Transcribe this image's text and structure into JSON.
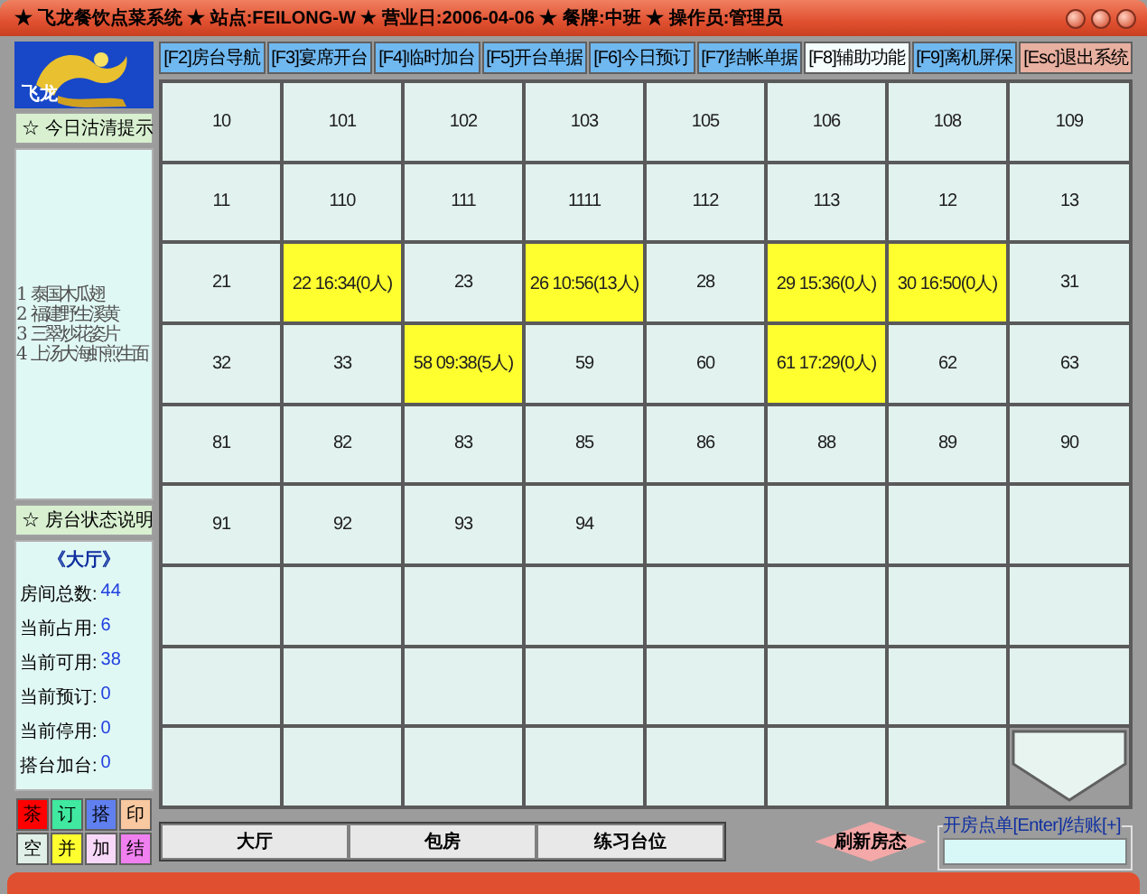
{
  "window": {
    "title": "★ 飞龙餐饮点菜系统 ★ 站点:FEILONG-W ★ 营业日:2006-04-06 ★ 餐牌:中班 ★ 操作员:管理员"
  },
  "logo": {
    "text": "飞龙"
  },
  "toolbar": [
    {
      "label": "[F2]房台导航",
      "selected": false,
      "kind": "normal"
    },
    {
      "label": "[F3]宴席开台",
      "selected": false,
      "kind": "normal"
    },
    {
      "label": "[F4]临时加台",
      "selected": false,
      "kind": "normal"
    },
    {
      "label": "[F5]开台单据",
      "selected": false,
      "kind": "normal"
    },
    {
      "label": "[F6]今日预订",
      "selected": false,
      "kind": "normal"
    },
    {
      "label": "[F7]结帐单据",
      "selected": false,
      "kind": "normal"
    },
    {
      "label": "[F8]辅助功能",
      "selected": true,
      "kind": "normal"
    },
    {
      "label": "[F9]离机屏保",
      "selected": false,
      "kind": "normal"
    },
    {
      "label": "[Esc]退出系统",
      "selected": false,
      "kind": "exit"
    }
  ],
  "sold_out": {
    "title": "☆ 今日沽清提示",
    "items": [
      {
        "number": "1",
        "name": "泰国木瓜翅"
      },
      {
        "number": "2",
        "name": "福建野生溪黄"
      },
      {
        "number": "3",
        "name": "三翠炒花姿片"
      },
      {
        "number": "4",
        "name": "上汤大海虾煎生面"
      }
    ]
  },
  "status_panel": {
    "title": "☆ 房台状态说明",
    "hall": "《大厅》",
    "stats": [
      {
        "label": "房间总数:",
        "value": "44"
      },
      {
        "label": "当前占用:",
        "value": "6"
      },
      {
        "label": "当前可用:",
        "value": "38"
      },
      {
        "label": "当前预订:",
        "value": "0"
      },
      {
        "label": "当前停用:",
        "value": "0"
      },
      {
        "label": "搭台加台:",
        "value": "0"
      }
    ],
    "legend": [
      {
        "label": "茶",
        "color": "#ff0000"
      },
      {
        "label": "订",
        "color": "#40e8a0"
      },
      {
        "label": "搭",
        "color": "#6080f0"
      },
      {
        "label": "印",
        "color": "#f8c8a0"
      },
      {
        "label": "空",
        "color": "#e0f0e8"
      },
      {
        "label": "并",
        "color": "#ffff30"
      },
      {
        "label": "加",
        "color": "#f8d8f8"
      },
      {
        "label": "结",
        "color": "#f080f0"
      }
    ]
  },
  "rooms": [
    {
      "label": "10",
      "occupied": false
    },
    {
      "label": "101",
      "occupied": false
    },
    {
      "label": "102",
      "occupied": false
    },
    {
      "label": "103",
      "occupied": false
    },
    {
      "label": "105",
      "occupied": false
    },
    {
      "label": "106",
      "occupied": false
    },
    {
      "label": "108",
      "occupied": false
    },
    {
      "label": "109",
      "occupied": false
    },
    {
      "label": "11",
      "occupied": false
    },
    {
      "label": "110",
      "occupied": false
    },
    {
      "label": "111",
      "occupied": false
    },
    {
      "label": "1111",
      "occupied": false
    },
    {
      "label": "112",
      "occupied": false
    },
    {
      "label": "113",
      "occupied": false
    },
    {
      "label": "12",
      "occupied": false
    },
    {
      "label": "13",
      "occupied": false
    },
    {
      "label": "21",
      "occupied": false
    },
    {
      "label": "22 16:34(0人)",
      "occupied": true
    },
    {
      "label": "23",
      "occupied": false
    },
    {
      "label": "26 10:56(13人)",
      "occupied": true
    },
    {
      "label": "28",
      "occupied": false
    },
    {
      "label": "29 15:36(0人)",
      "occupied": true
    },
    {
      "label": "30 16:50(0人)",
      "occupied": true
    },
    {
      "label": "31",
      "occupied": false
    },
    {
      "label": "32",
      "occupied": false
    },
    {
      "label": "33",
      "occupied": false
    },
    {
      "label": "58 09:38(5人)",
      "occupied": true
    },
    {
      "label": "59",
      "occupied": false
    },
    {
      "label": "60",
      "occupied": false
    },
    {
      "label": "61 17:29(0人)",
      "occupied": true
    },
    {
      "label": "62",
      "occupied": false
    },
    {
      "label": "63",
      "occupied": false
    },
    {
      "label": "81",
      "occupied": false
    },
    {
      "label": "82",
      "occupied": false
    },
    {
      "label": "83",
      "occupied": false
    },
    {
      "label": "85",
      "occupied": false
    },
    {
      "label": "86",
      "occupied": false
    },
    {
      "label": "88",
      "occupied": false
    },
    {
      "label": "89",
      "occupied": false
    },
    {
      "label": "90",
      "occupied": false
    },
    {
      "label": "91",
      "occupied": false
    },
    {
      "label": "92",
      "occupied": false
    },
    {
      "label": "93",
      "occupied": false
    },
    {
      "label": "94",
      "occupied": false
    }
  ],
  "area_tabs": [
    {
      "label": "大厅"
    },
    {
      "label": "包房"
    },
    {
      "label": "练习台位"
    }
  ],
  "refresh_button": {
    "label": "刷新房态"
  },
  "order_field": {
    "legend": "开房点单[Enter]/结账[+]"
  }
}
